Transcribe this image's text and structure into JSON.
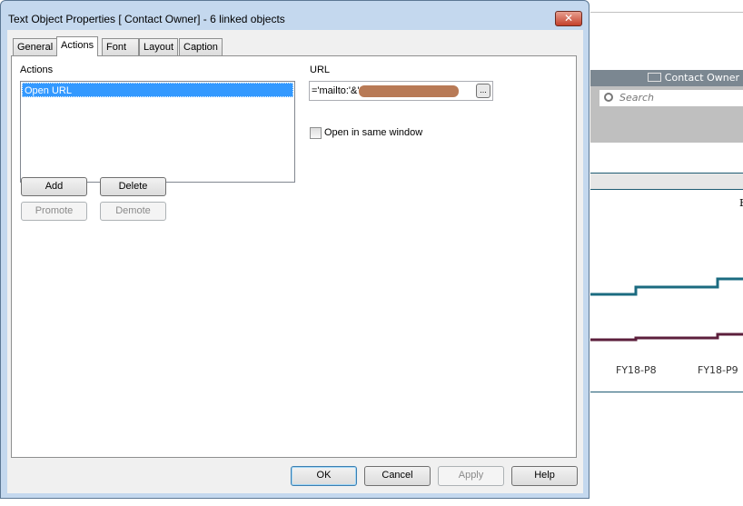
{
  "dialog": {
    "title": "Text Object Properties [  Contact Owner] - 6 linked objects",
    "close_glyph": "✕",
    "tabs": [
      {
        "label": "General",
        "active": false
      },
      {
        "label": "Actions",
        "active": true
      },
      {
        "label": "Font",
        "active": false
      },
      {
        "label": "Layout",
        "active": false
      },
      {
        "label": "Caption",
        "active": false
      }
    ],
    "actions_label": "Actions",
    "actions_list": [
      {
        "label": "Open URL",
        "selected": true
      }
    ],
    "url_label": "URL",
    "url_value": "='mailto:'&'",
    "url_browse": "...",
    "open_same_window_label": "Open in same window",
    "open_same_window_checked": false,
    "buttons": {
      "add": "Add",
      "delete": "Delete",
      "promote": "Promote",
      "demote": "Demote"
    },
    "footer": {
      "ok": "OK",
      "cancel": "Cancel",
      "apply": "Apply",
      "help": "Help"
    }
  },
  "background": {
    "contact_owner": "Contact Owner",
    "search_placeholder": "Search",
    "partial_letter": "F",
    "x_labels": [
      "FY18-P8",
      "FY18-P9"
    ],
    "colors": {
      "series_1": "#1b6b80",
      "series_2": "#5c1f3c",
      "header": "#7b8791"
    }
  }
}
